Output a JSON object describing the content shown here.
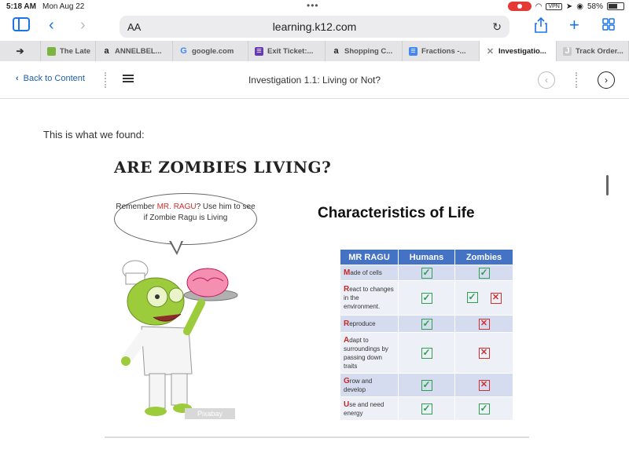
{
  "status": {
    "time": "5:18 AM",
    "date": "Mon Aug 22",
    "vpn": "VPN",
    "battery": "58%"
  },
  "browser": {
    "aa": "AA",
    "url": "learning.k12.com"
  },
  "tabs": [
    {
      "label": "The Late",
      "icon": "leaf-icon",
      "color": "#7cb342",
      "glyph": ""
    },
    {
      "label": "ANNELBEL...",
      "icon": "amazon-icon",
      "color": "#222",
      "glyph": "a"
    },
    {
      "label": "google.com",
      "icon": "google-icon",
      "color": "#4285f4",
      "glyph": "G"
    },
    {
      "label": "Exit Ticket:...",
      "icon": "forms-icon",
      "color": "#673ab7",
      "glyph": "≡"
    },
    {
      "label": "Shopping C...",
      "icon": "amazon-icon",
      "color": "#222",
      "glyph": "a"
    },
    {
      "label": "Fractions -...",
      "icon": "docs-icon",
      "color": "#4285f4",
      "glyph": "≡"
    },
    {
      "label": "Investigatio...",
      "icon": "close-icon",
      "color": "#888",
      "glyph": "✕"
    },
    {
      "label": "Track Order...",
      "icon": "j-icon",
      "color": "#c8c8cc",
      "glyph": "J"
    }
  ],
  "header": {
    "back_label": "Back to Content",
    "title": "Investigation 1.1: Living or Not?"
  },
  "content": {
    "intro": "This is what we found:",
    "figure_title": "ARE ZOMBIES LIVING?",
    "bubble_pre": "Remember ",
    "bubble_name": "MR. RAGU",
    "bubble_post": "? Use him to see if Zombie Ragu is Living",
    "chart_title": "Characteristics of Life",
    "watermark": "Pixabay",
    "table": {
      "headers": [
        "MR RAGU",
        "Humans",
        "Zombies"
      ],
      "rows": [
        {
          "letter": "M",
          "rest": "ade of cells",
          "humans": [
            "check"
          ],
          "zombies": [
            "check"
          ]
        },
        {
          "letter": "R",
          "rest": "eact to changes in the environment.",
          "humans": [
            "check"
          ],
          "zombies": [
            "check",
            "x"
          ]
        },
        {
          "letter": "R",
          "rest": "eproduce",
          "humans": [
            "check"
          ],
          "zombies": [
            "x"
          ]
        },
        {
          "letter": "A",
          "rest": "dapt to surroundings by passing down traits",
          "humans": [
            "check"
          ],
          "zombies": [
            "x"
          ]
        },
        {
          "letter": "G",
          "rest": "row and develop",
          "humans": [
            "check"
          ],
          "zombies": [
            "x"
          ]
        },
        {
          "letter": "U",
          "rest": "se and need energy",
          "humans": [
            "check"
          ],
          "zombies": [
            "check"
          ]
        }
      ]
    }
  }
}
